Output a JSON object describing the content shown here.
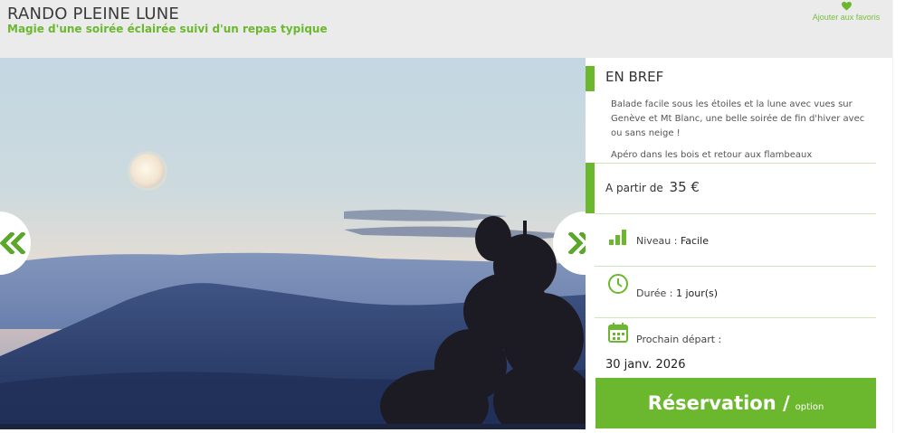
{
  "header": {
    "title": "RANDO PLEINE LUNE",
    "subtitle": "Magie d'une soirée éclairée suivi d'un repas typique",
    "favorite_label": "Ajouter aux favoris"
  },
  "gallery": {
    "prev_label": "«",
    "next_label": "»"
  },
  "summary": {
    "heading": "EN BREF",
    "description": [
      "Balade facile sous les étoiles et la lune avec vues sur Genève et Mt Blanc, une belle soirée de fin d'hiver avec ou sans neige !",
      "Apéro dans les bois et retour aux flambeaux"
    ],
    "price_prefix": "A partir de",
    "price_value": "35 €",
    "level_label": "Niveau : ",
    "level_value": "Facile",
    "duration_label": "Durée : ",
    "duration_value": "1 jour(s)",
    "next_departure_label": "Prochain départ :",
    "next_departure_date": "30 janv. 2026"
  },
  "booking": {
    "label": "Réservation /",
    "option_label": "option"
  },
  "colors": {
    "accent": "#6bb82f",
    "header_bg": "#ebebeb"
  },
  "icons": {
    "favorite": "heart-icon",
    "level": "signal-bars-icon",
    "duration": "clock-icon",
    "departure": "calendar-icon"
  }
}
